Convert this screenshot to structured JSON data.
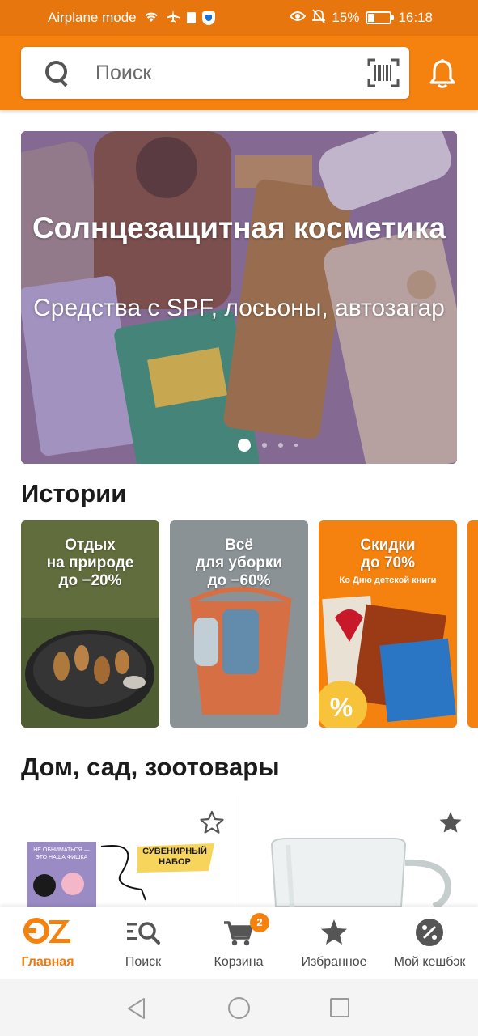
{
  "status_bar": {
    "left_text": "Airplane mode",
    "battery": "15%",
    "time": "16:18"
  },
  "header": {
    "search_placeholder": "Поиск",
    "icons": [
      "search-icon",
      "barcode-icon",
      "bell-icon"
    ]
  },
  "banner": {
    "title": "Солнцезащитная косметика",
    "subtitle": "Средства с SPF, лосьоны, автозагар",
    "slide_count": 4,
    "active_slide": 1
  },
  "stories": {
    "title": "Истории",
    "items": [
      {
        "text": "Отдых\nна природе\nдо −20%"
      },
      {
        "text": "Всё\nдля уборки\nдо −60%"
      },
      {
        "text": "Скидки\nдо 70%",
        "subtext": "Ко Дню детской книги"
      }
    ]
  },
  "products_section": {
    "title": "Дом, сад, зоотовары",
    "cards": [
      {
        "favorite": false,
        "sticker": "СУВЕНИРНЫЙ\nНАБОР",
        "book_caption": "НЕ ОБНИМАТЬСЯ —\nЭТО НАША ФИШКА"
      },
      {
        "favorite": true
      }
    ]
  },
  "bottom_nav": {
    "items": [
      {
        "label": "Главная",
        "icon": "oz-logo-icon",
        "active": true
      },
      {
        "label": "Поиск",
        "icon": "catalog-search-icon"
      },
      {
        "label": "Корзина",
        "icon": "cart-icon",
        "badge": "2"
      },
      {
        "label": "Избранное",
        "icon": "star-icon"
      },
      {
        "label": "Мой кешбэк",
        "icon": "cashback-icon"
      }
    ]
  },
  "colors": {
    "brand_orange": "#f5820f",
    "status_bar": "#e8760f",
    "active_label": "#ef7a0e"
  }
}
